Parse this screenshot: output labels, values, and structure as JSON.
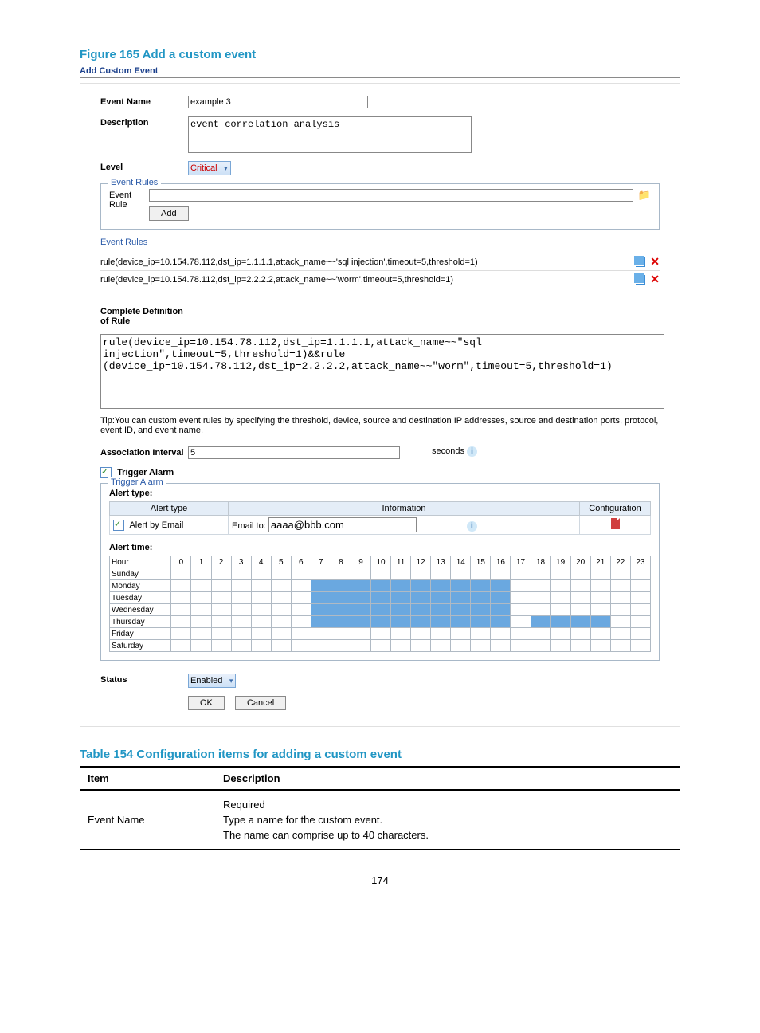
{
  "figure_caption": "Figure 165 Add a custom event",
  "panel_title": "Add Custom Event",
  "labels": {
    "event_name": "Event Name",
    "description": "Description",
    "level": "Level",
    "event_rules_legend": "Event Rules",
    "event_rule": "Event Rule",
    "add_btn": "Add",
    "event_rules_hdr": "Event Rules",
    "complete_def": "Complete Definition of Rule",
    "assoc_interval": "Association Interval",
    "seconds": "seconds",
    "trigger_alarm": "Trigger Alarm",
    "trigger_legend": "Trigger Alarm",
    "alert_type": "Alert type:",
    "alert_type_col": "Alert type",
    "info_col": "Information",
    "config_col": "Configuration",
    "alert_by_email": "Alert by Email",
    "email_to": "Email to:",
    "alert_time": "Alert time:",
    "hour": "Hour",
    "days": [
      "Sunday",
      "Monday",
      "Tuesday",
      "Wednesday",
      "Thursday",
      "Friday",
      "Saturday"
    ],
    "status": "Status",
    "ok": "OK",
    "cancel": "Cancel"
  },
  "values": {
    "event_name": "example 3",
    "description": "event correlation analysis",
    "level": "Critical",
    "event_rule": "",
    "rules": [
      "rule(device_ip=10.154.78.112,dst_ip=1.1.1.1,attack_name~~'sql injection',timeout=5,threshold=1)",
      "rule(device_ip=10.154.78.112,dst_ip=2.2.2.2,attack_name~~'worm',timeout=5,threshold=1)"
    ],
    "complete_def": "rule(device_ip=10.154.78.112,dst_ip=1.1.1.1,attack_name~~\"sql injection\",timeout=5,threshold=1)&&rule (device_ip=10.154.78.112,dst_ip=2.2.2.2,attack_name~~\"worm\",timeout=5,threshold=1)",
    "tip": "Tip:You can custom event rules by specifying the threshold, device, source and destination IP addresses, source and destination ports, protocol, event ID, and event name.",
    "assoc_interval": "5",
    "email_to": "aaaa@bbb.com",
    "status": "Enabled"
  },
  "table_caption": "Table 154 Configuration items for adding a custom event",
  "table": {
    "head_item": "Item",
    "head_desc": "Description",
    "rows": [
      {
        "item": "Event Name",
        "desc": [
          "Required",
          "Type a name for the custom event.",
          "The name can comprise up to 40 characters."
        ]
      }
    ]
  },
  "page_number": "174"
}
